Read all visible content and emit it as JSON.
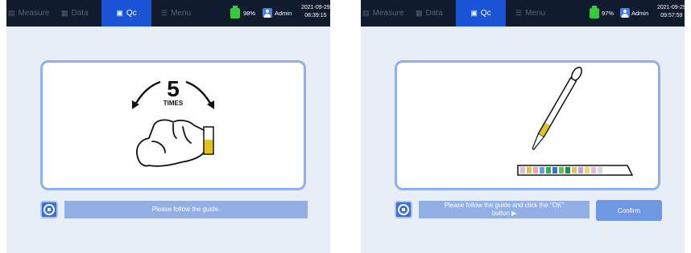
{
  "left": {
    "tabs": {
      "measure": "Measure",
      "data": "Data",
      "qc": "Qc",
      "menu": "Menu"
    },
    "battery": "98%",
    "user": "Admin",
    "date": "2021-09-29",
    "time": "08:39:15",
    "guide": {
      "count": "5",
      "count_unit": "TIMES"
    },
    "message": "Please follow the guide."
  },
  "right": {
    "tabs": {
      "measure": "Measure",
      "data": "Data",
      "qc": "Qc",
      "menu": "Menu"
    },
    "battery": "97%",
    "user": "Admin",
    "date": "2021-09-29",
    "time": "09:57:59",
    "message_line1": "Please follow the guide and click the \"OK\"",
    "message_line2": "button ▶",
    "confirm": "Confirm"
  },
  "colors": {
    "topbar": "#101b2e",
    "tab_active": "#1b53d6",
    "screen_bg": "#e8eef8",
    "frame_border": "#8fb0ee",
    "message_bar": "#92b0e6",
    "confirm_button": "#6e98e3",
    "battery": "#36c93b",
    "liquid": "#e5c21a"
  },
  "icons": {
    "measure": "list-icon",
    "data": "document-icon",
    "qc": "test-tube-icon",
    "menu": "menu-icon",
    "battery": "battery-icon",
    "user": "user-icon",
    "stop": "stop-icon"
  }
}
